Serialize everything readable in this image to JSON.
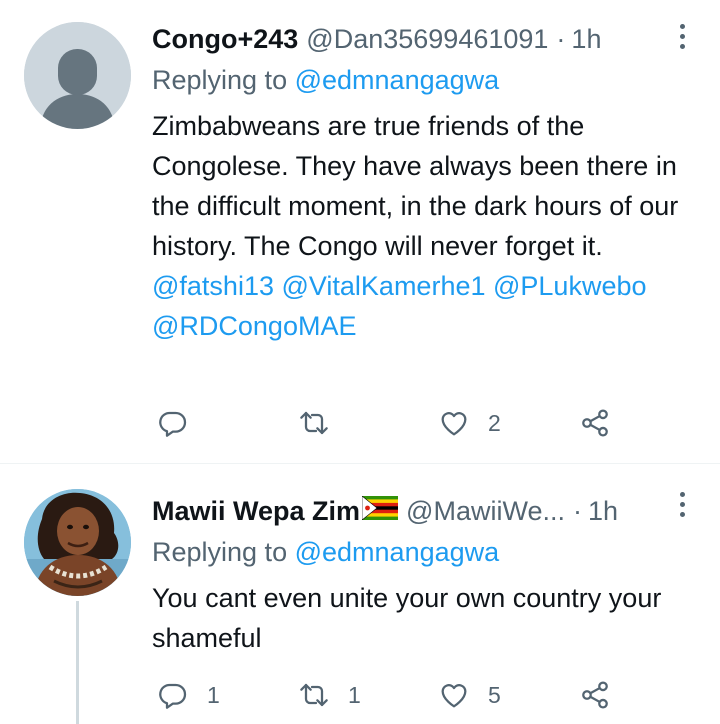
{
  "tweets": [
    {
      "display_name": "Congo+243",
      "handle": "@Dan35699461091",
      "separator": "·",
      "time": "1h",
      "replying_label": "Replying to",
      "replying_to": "@edmnangagwa",
      "text": "Zimbabweans are true friends of the Congolese. They have always been there in the difficult moment, in the dark hours of our history. The Congo will never forget it.",
      "mentions": "@fatshi13 @VitalKamerhe1 @PLukwebo @RDCongoMAE",
      "counts": {
        "replies": "",
        "retweets": "",
        "likes": "2"
      }
    },
    {
      "display_name": "Mawii Wepa Zim",
      "handle": "@MawiiWe...",
      "separator": "·",
      "time": "1h",
      "replying_label": "Replying to",
      "replying_to": "@edmnangagwa",
      "text": "You cant even unite your own country your shameful",
      "counts": {
        "replies": "1",
        "retweets": "1",
        "likes": "5"
      }
    }
  ],
  "colors": {
    "accent": "#1d9bf0",
    "secondary": "#536471",
    "text": "#0f1419"
  },
  "icons": [
    "default-avatar-icon",
    "profile-photo",
    "zimbabwe-flag-icon",
    "more-icon",
    "reply-icon",
    "retweet-icon",
    "like-icon",
    "share-icon"
  ]
}
